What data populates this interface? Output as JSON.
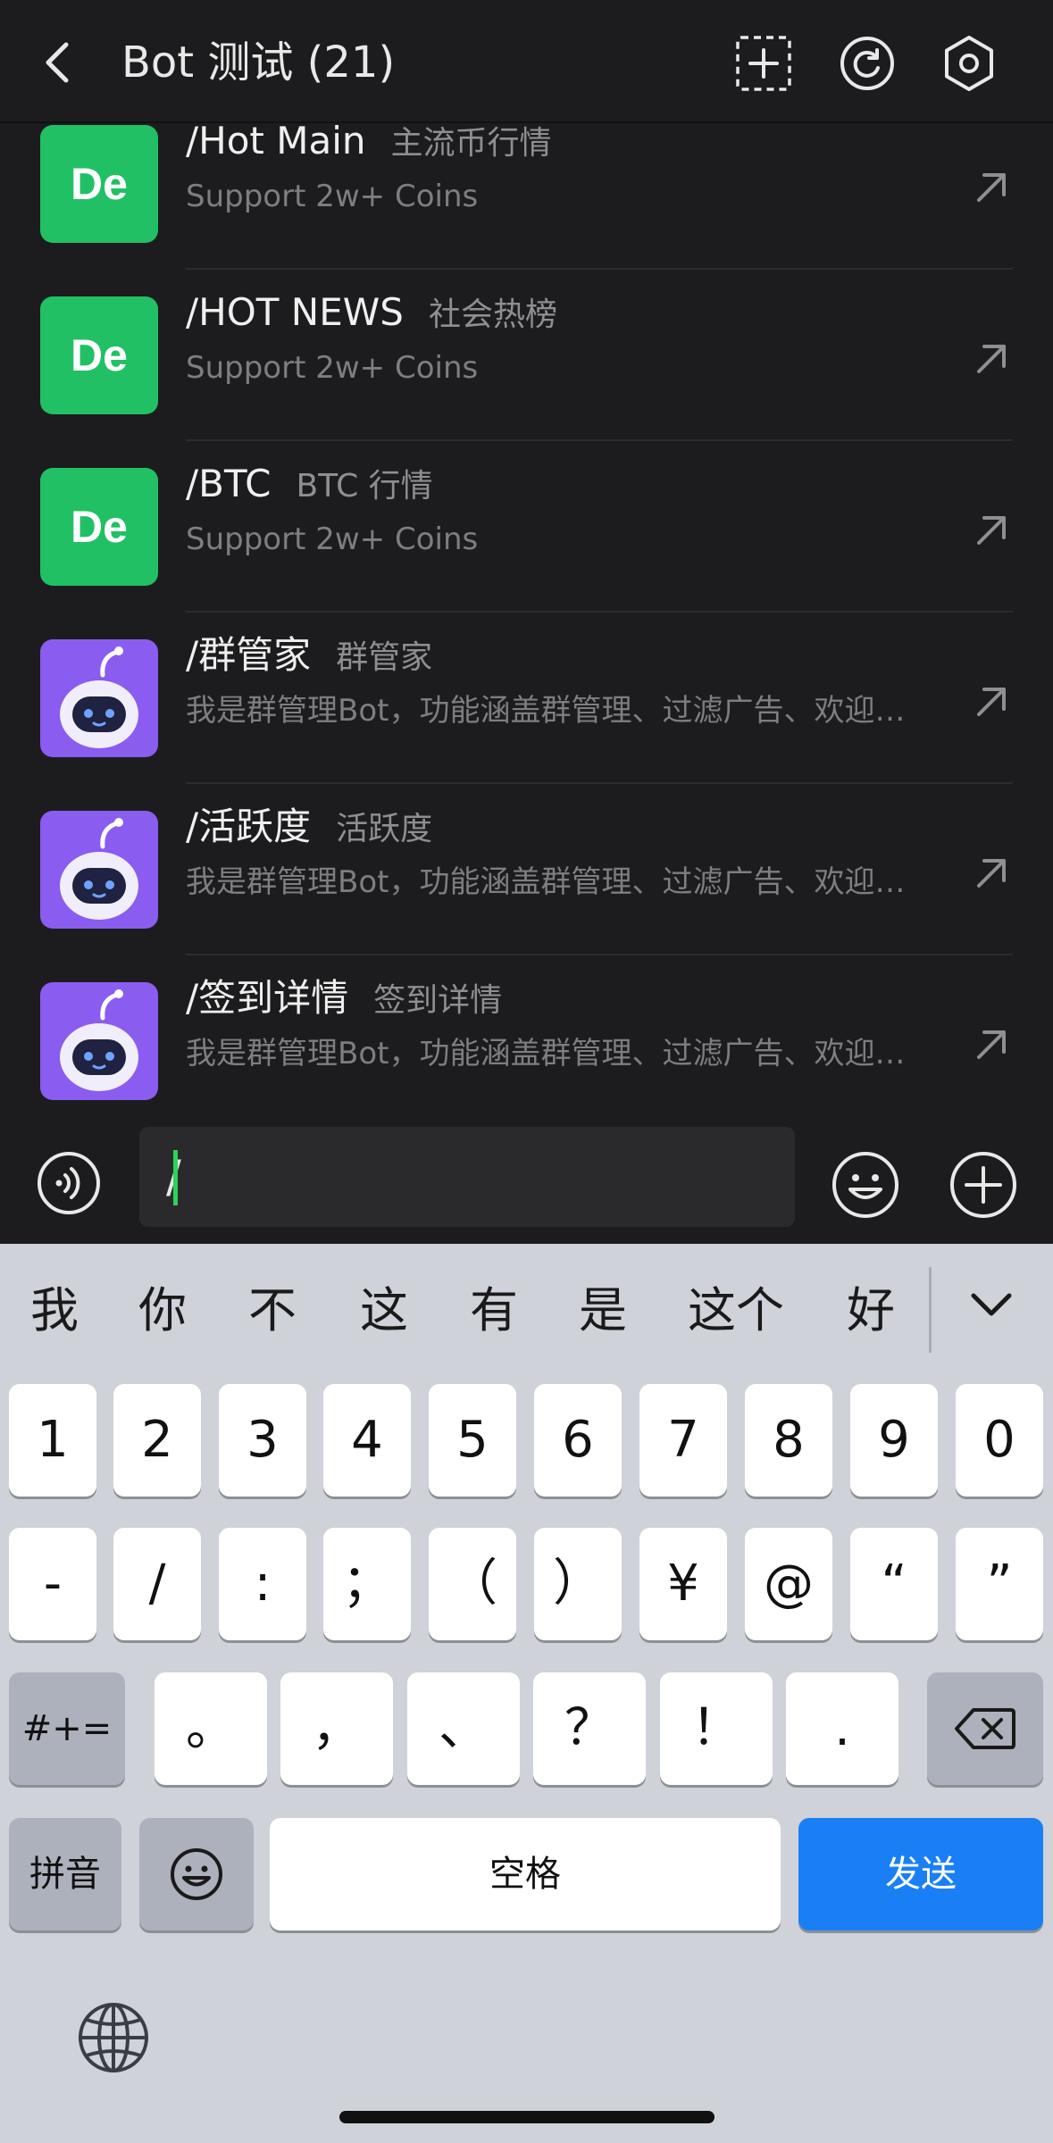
{
  "header": {
    "title": "Bot 测试 (21)",
    "icons": [
      "chevron-left-icon",
      "add-box-icon",
      "refresh-icon",
      "settings-icon"
    ]
  },
  "bots": [
    {
      "command": "/Hot Main",
      "name": "主流币行情",
      "desc": "Support 2w+ Coins",
      "avatar": "De",
      "avatar_color": "#22c064"
    },
    {
      "command": "/HOT NEWS",
      "name": "社会热榜",
      "desc": "Support 2w+ Coins",
      "avatar": "De",
      "avatar_color": "#22c064"
    },
    {
      "command": "/BTC",
      "name": "BTC 行情",
      "desc": "Support 2w+ Coins",
      "avatar": "De",
      "avatar_color": "#22c064"
    },
    {
      "command": "/群管家",
      "name": "群管家",
      "desc": "我是群管理Bot，功能涵盖群管理、过滤广告、欢迎新成员等",
      "avatar_icon": "robot-avatar-icon",
      "avatar_color": "#8a5cf0"
    },
    {
      "command": "/活跃度",
      "name": "活跃度",
      "desc": "我是群管理Bot，功能涵盖群管理、过滤广告、欢迎新成员等",
      "avatar_icon": "robot-avatar-icon",
      "avatar_color": "#8a5cf0"
    },
    {
      "command": "/签到详情",
      "name": "签到详情",
      "desc": "我是群管理Bot，功能涵盖群管理、过滤广告、欢迎新成员等",
      "avatar_icon": "robot-avatar-icon",
      "avatar_color": "#8a5cf0"
    }
  ],
  "input": {
    "value": "/",
    "icons": [
      "voice-icon",
      "emoji-icon",
      "plus-circle-icon"
    ]
  },
  "keyboard": {
    "candidates": [
      "我",
      "你",
      "不",
      "这",
      "有",
      "是",
      "这个",
      "好"
    ],
    "row_numbers": [
      "1",
      "2",
      "3",
      "4",
      "5",
      "6",
      "7",
      "8",
      "9",
      "0"
    ],
    "row_symbols": [
      "-",
      "/",
      ":",
      "；",
      "（",
      "）",
      "¥",
      "@",
      "“",
      "”"
    ],
    "row_punct": [
      "。",
      "，",
      "、",
      "？",
      "！",
      "."
    ],
    "more_symbols": "#+=",
    "pinyin": "拼音",
    "space": "空格",
    "send": "发送",
    "accent_color": "#1a7ff5"
  }
}
